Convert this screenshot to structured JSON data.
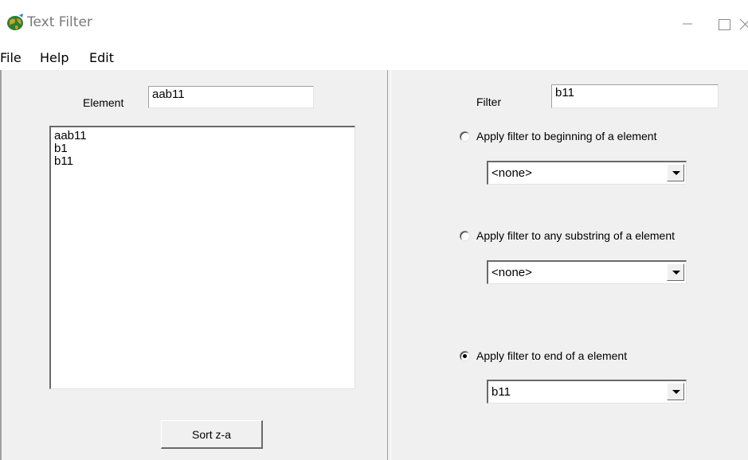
{
  "window": {
    "title": "Text Filter",
    "icons": {
      "app": "globe-app-icon",
      "minimize": "minimize-icon",
      "maximize": "maximize-icon",
      "close": "close-icon"
    }
  },
  "menu": {
    "items": [
      "File",
      "Help",
      "Edit"
    ]
  },
  "left_panel": {
    "element_label": "Element",
    "element_value": "aab11",
    "list_items": [
      "aab11",
      "b1",
      "b11"
    ],
    "sort_button_label": "Sort z-a"
  },
  "right_panel": {
    "filter_label": "Filter",
    "filter_value": "b11",
    "options": [
      {
        "label": "Apply filter to beginning of a element",
        "selected": false,
        "combo_value": "<none>"
      },
      {
        "label": "Apply filter to any substring of a element",
        "selected": false,
        "combo_value": "<none>"
      },
      {
        "label": "Apply filter to end of a element",
        "selected": true,
        "combo_value": "b11"
      }
    ]
  }
}
